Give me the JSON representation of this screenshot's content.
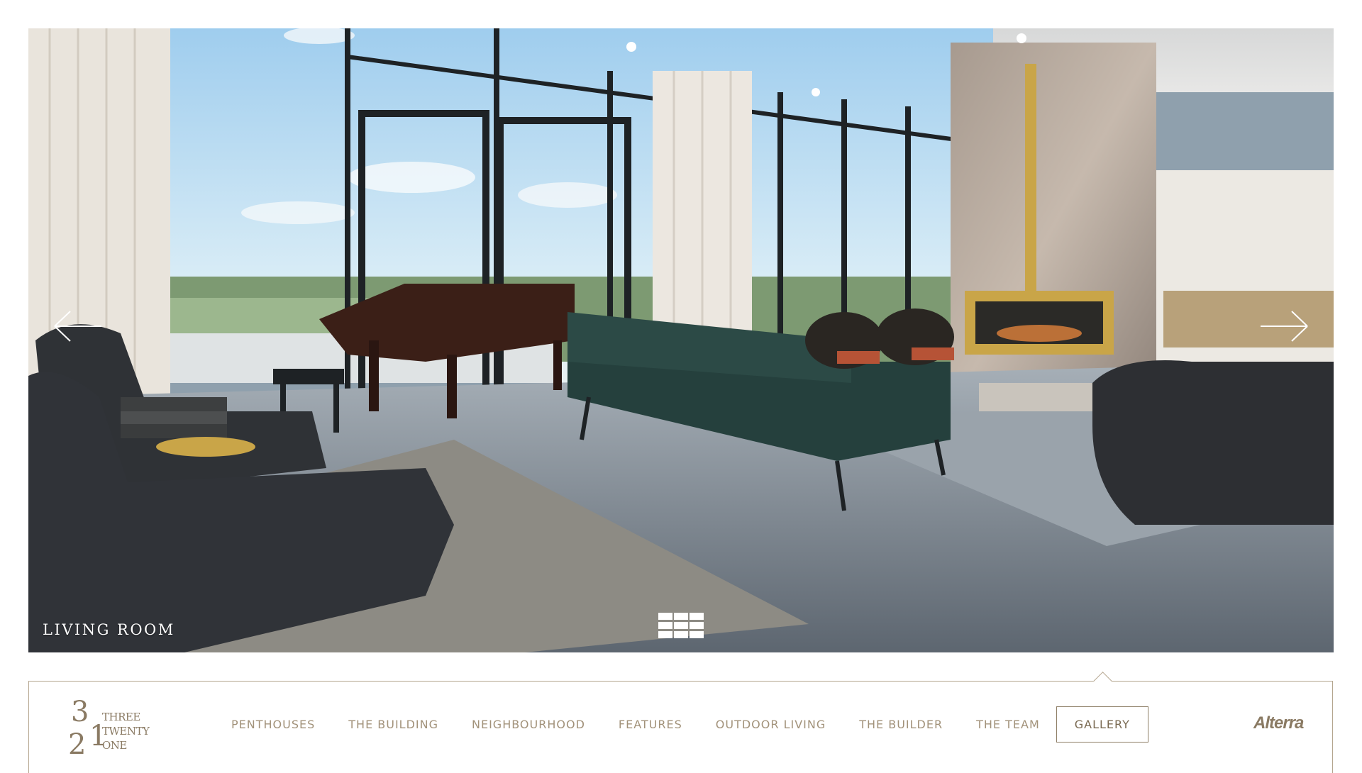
{
  "gallery": {
    "caption": "LIVING ROOM",
    "prev_icon": "arrow-left-icon",
    "next_icon": "arrow-right-icon",
    "grid_icon": "grid-icon"
  },
  "brand_logo": {
    "numeral_top": "3",
    "numeral_mid": "2",
    "numeral_bottom": "1",
    "line1": "THREE",
    "line2": "TWENTY",
    "line3": "ONE"
  },
  "nav": {
    "items": [
      {
        "label": "PENTHOUSES"
      },
      {
        "label": "THE BUILDING"
      },
      {
        "label": "NEIGHBOURHOOD"
      },
      {
        "label": "FEATURES"
      },
      {
        "label": "OUTDOOR LIVING"
      },
      {
        "label": "THE BUILDER"
      },
      {
        "label": "THE TEAM"
      },
      {
        "label": "GALLERY"
      }
    ],
    "active_label": "GALLERY"
  },
  "builder_logo": "Alterra",
  "colors": {
    "accent": "#a2927a",
    "border": "#b4a58e"
  }
}
